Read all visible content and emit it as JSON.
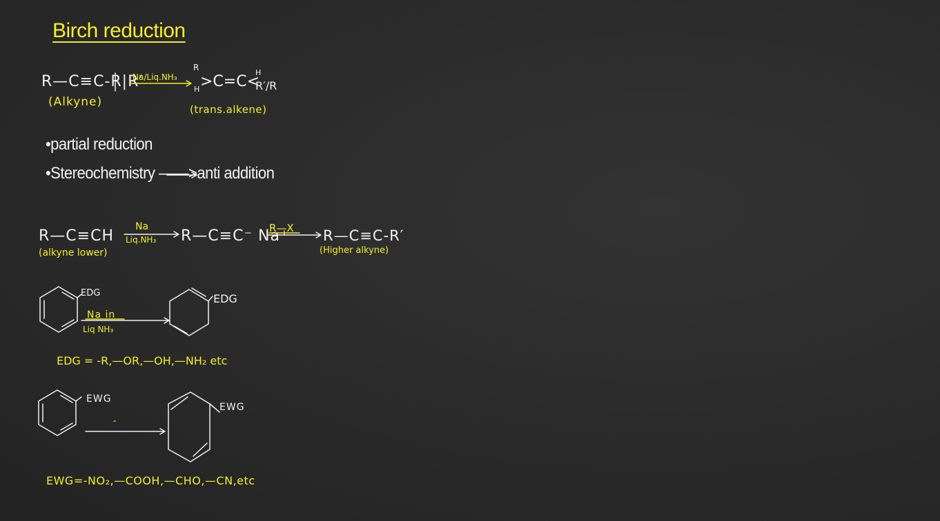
{
  "title": "Birch reduction",
  "eq1": {
    "reactant": "R—C≡C-R|R′",
    "reagent": "Na/Liq.NH₃",
    "product_left_top": "R",
    "product_left_bottom": "H",
    "product_core": ">C=C<",
    "product_right_top": "H",
    "product_right_bottom": "R′/R",
    "reactant_label": "(Alkyne)",
    "product_label": "(trans.alkene)"
  },
  "bullets": [
    "•partial reduction",
    "•Stereochemistry ——>anti addition"
  ],
  "eq2": {
    "reactant": "R—C≡CH",
    "reagent_top": "Na",
    "reagent_bottom": "Liq.NH₃",
    "intermediate": "R—C≡C⁻ Na⁺",
    "reagent2": "R—X",
    "product": "R—C≡C-R′",
    "reactant_label": "(alkyne lower)",
    "product_label": "(Higher alkyne)"
  },
  "edg": {
    "substituent_label": "EDG",
    "reagent_top": "Na in",
    "reagent_bottom": "Liq NH₃",
    "product_label": "EDG",
    "definition": "EDG = -R,—OR,—OH,—NH₂ etc"
  },
  "ewg": {
    "substituent_label": "EWG",
    "reagent": "″",
    "product_label": "EWG",
    "definition": "EWG=-NO₂,—COOH,—CHO,—CN,etc"
  },
  "colors": {
    "chalk": "#f2f2f2",
    "highlight": "#f5ee2a",
    "board": "#2b2b2b"
  }
}
